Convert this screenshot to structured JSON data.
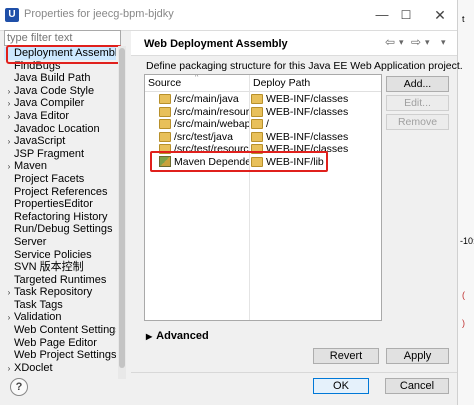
{
  "window": {
    "title": "Properties for jeecg-bpm-bjdky",
    "app_icon": "U",
    "controls": {
      "minimize": "—",
      "maximize": "☐",
      "close": "✕"
    }
  },
  "edge": {
    "t1": "t",
    "t2": "-10:",
    "t3": "(",
    "t4": ")"
  },
  "filter": {
    "placeholder": "type filter text"
  },
  "nav": {
    "items": [
      {
        "label": "Deployment Assembly",
        "twisty": "",
        "selected": true
      },
      {
        "label": "FindBugs",
        "twisty": ""
      },
      {
        "label": "Java Build Path",
        "twisty": ""
      },
      {
        "label": "Java Code Style",
        "twisty": "›"
      },
      {
        "label": "Java Compiler",
        "twisty": "›"
      },
      {
        "label": "Java Editor",
        "twisty": "›"
      },
      {
        "label": "Javadoc Location",
        "twisty": ""
      },
      {
        "label": "JavaScript",
        "twisty": "›"
      },
      {
        "label": "JSP Fragment",
        "twisty": ""
      },
      {
        "label": "Maven",
        "twisty": "›"
      },
      {
        "label": "Project Facets",
        "twisty": ""
      },
      {
        "label": "Project References",
        "twisty": ""
      },
      {
        "label": "PropertiesEditor",
        "twisty": ""
      },
      {
        "label": "Refactoring History",
        "twisty": ""
      },
      {
        "label": "Run/Debug Settings",
        "twisty": ""
      },
      {
        "label": "Server",
        "twisty": ""
      },
      {
        "label": "Service Policies",
        "twisty": ""
      },
      {
        "label": "SVN 版本控制",
        "twisty": ""
      },
      {
        "label": "Targeted Runtimes",
        "twisty": ""
      },
      {
        "label": "Task Repository",
        "twisty": "›"
      },
      {
        "label": "Task Tags",
        "twisty": ""
      },
      {
        "label": "Validation",
        "twisty": "›"
      },
      {
        "label": "Web Content Settings",
        "twisty": ""
      },
      {
        "label": "Web Page Editor",
        "twisty": ""
      },
      {
        "label": "Web Project Settings",
        "twisty": ""
      },
      {
        "label": "XDoclet",
        "twisty": "›"
      }
    ]
  },
  "panel": {
    "title": "Web Deployment Assembly",
    "arrows": {
      "back": "⇦",
      "back_menu": "▾",
      "forward": "⇨",
      "forward_menu": "▾",
      "menu": "▾"
    },
    "description": "Define packaging structure for this Java EE Web Application project."
  },
  "table": {
    "headers": {
      "source": "Source",
      "deploy": "Deploy Path"
    },
    "sort_indicator": "^",
    "rows": [
      {
        "icon": "folder",
        "source": "/src/main/java",
        "deploy": "WEB-INF/classes"
      },
      {
        "icon": "folder",
        "source": "/src/main/resources",
        "deploy": "WEB-INF/classes"
      },
      {
        "icon": "folder",
        "source": "/src/main/webapp",
        "deploy": "/"
      },
      {
        "icon": "folder",
        "source": "/src/test/java",
        "deploy": "WEB-INF/classes"
      },
      {
        "icon": "folder",
        "source": "/src/test/resources",
        "deploy": "WEB-INF/classes"
      },
      {
        "icon": "jar",
        "source": "Maven Dependencies",
        "deploy": "WEB-INF/lib"
      }
    ]
  },
  "side_buttons": {
    "add": "Add...",
    "edit": "Edit...",
    "remove": "Remove"
  },
  "advanced": {
    "twisty": "▶",
    "label": "Advanced"
  },
  "buttons": {
    "revert": "Revert",
    "apply": "Apply",
    "ok": "OK",
    "cancel": "Cancel"
  },
  "help": "?"
}
